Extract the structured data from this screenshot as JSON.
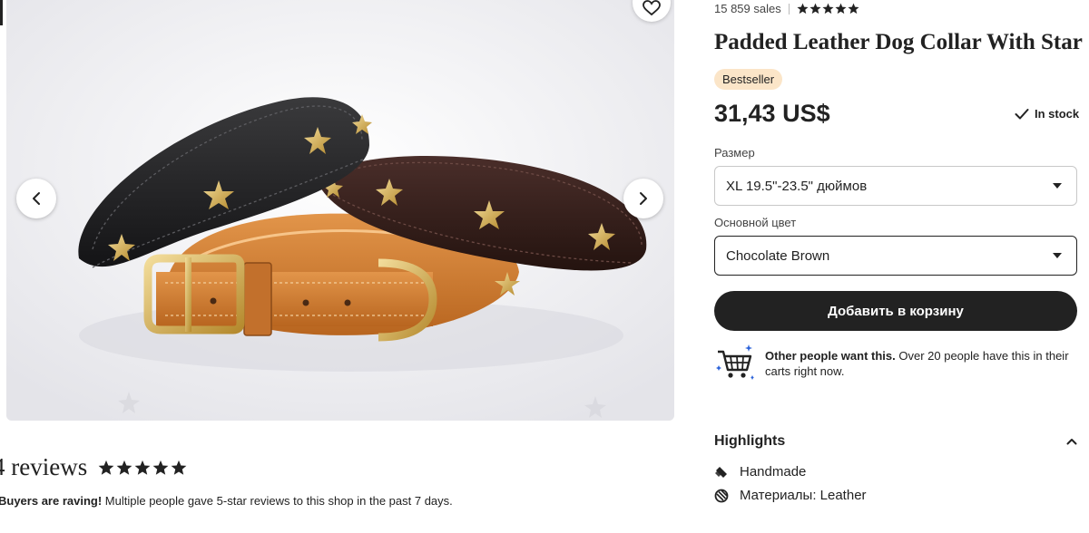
{
  "gallery": {
    "prev_label": "‹",
    "next_label": "›"
  },
  "reviews": {
    "title": "4 reviews",
    "rating": 5,
    "note_bold": "Buyers are raving!",
    "note_text": " Multiple people gave 5-star reviews to this shop in the past 7 days."
  },
  "product": {
    "sales": "15 859 sales",
    "rating": 5,
    "title": "Padded Leather Dog Collar With Star",
    "badge": "Bestseller",
    "price": "31,43 US$",
    "stock": "In stock",
    "size_label": "Размер",
    "size_value": "XL 19.5\"-23.5\" дюймов",
    "color_label": "Основной цвет",
    "color_value": "Chocolate Brown",
    "add_to_cart": "Добавить в корзину",
    "demand_bold": "Other people want this.",
    "demand_text": " Over 20 people have this in their carts right now."
  },
  "highlights": {
    "title": "Highlights",
    "items": [
      {
        "icon": "handmade-icon",
        "label": "Handmade"
      },
      {
        "icon": "materials-icon",
        "label": "Материалы: Leather"
      }
    ]
  },
  "colors": {
    "text": "#222222",
    "badge_bg": "#fbe5c8",
    "button_bg": "#222222",
    "image_bg": "#f0f0f2"
  }
}
